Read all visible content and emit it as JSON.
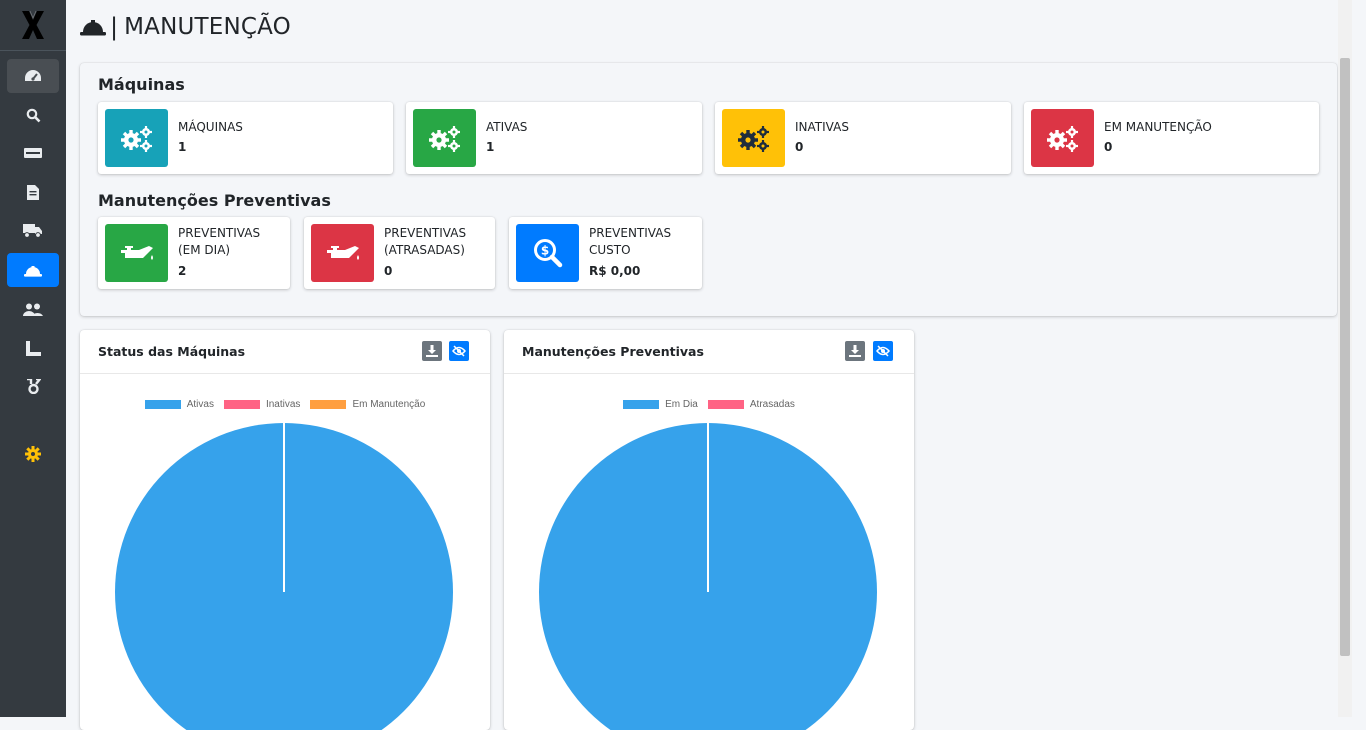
{
  "brand": {
    "logo": "X"
  },
  "sidebar": {
    "items": [
      {
        "icon": "tachometer-icon"
      },
      {
        "icon": "search-icon"
      },
      {
        "icon": "id-card-icon"
      },
      {
        "icon": "file-icon"
      },
      {
        "icon": "truck-icon"
      },
      {
        "icon": "hard-hat-icon",
        "active": true
      },
      {
        "icon": "users-icon"
      },
      {
        "icon": "ruler-combined-icon"
      },
      {
        "icon": "flask-icon"
      },
      {
        "icon": "gear-icon"
      }
    ]
  },
  "header": {
    "title": "MANUTENÇÃO",
    "separator": "|",
    "icon": "hard-hat-icon"
  },
  "maquinas": {
    "title": "Máquinas",
    "boxes": [
      {
        "label": "MÁQUINAS",
        "value": "1",
        "color": "#17a2b8",
        "icon": "cogs-icon"
      },
      {
        "label": "ATIVAS",
        "value": "1",
        "color": "#28a745",
        "icon": "cogs-icon"
      },
      {
        "label": "INATIVAS",
        "value": "0",
        "color": "#ffc107",
        "icon": "cogs-icon"
      },
      {
        "label": "EM MANUTENÇÃO",
        "value": "0",
        "color": "#dc3545",
        "icon": "cogs-icon"
      }
    ]
  },
  "preventivas": {
    "title": "Manutenções Preventivas",
    "boxes": [
      {
        "label_line1": "PREVENTIVAS",
        "label_line2": "(EM DIA)",
        "value": "2",
        "color": "#28a745",
        "icon": "oil-can-icon"
      },
      {
        "label_line1": "PREVENTIVAS",
        "label_line2": "(ATRASADAS)",
        "value": "0",
        "color": "#dc3545",
        "icon": "oil-can-icon"
      },
      {
        "label_line1": "PREVENTIVAS",
        "label_line2": "CUSTO",
        "value": "R$ 0,00",
        "color": "#007bff",
        "icon": "search-dollar-icon"
      }
    ]
  },
  "charts": {
    "status": {
      "title": "Status das Máquinas",
      "legend": [
        "Ativas",
        "Inativas",
        "Em Manutenção"
      ]
    },
    "preventivas": {
      "title": "Manutenções Preventivas",
      "legend": [
        "Em Dia",
        "Atrasadas"
      ]
    }
  },
  "chart_data": [
    {
      "type": "pie",
      "title": "Status das Máquinas",
      "categories": [
        "Ativas",
        "Inativas",
        "Em Manutenção"
      ],
      "values": [
        1,
        0,
        0
      ],
      "colors": [
        "#36a2eb",
        "#ff6384",
        "#ff9f40"
      ],
      "legend_position": "top"
    },
    {
      "type": "pie",
      "title": "Manutenções Preventivas",
      "categories": [
        "Em Dia",
        "Atrasadas"
      ],
      "values": [
        2,
        0
      ],
      "colors": [
        "#36a2eb",
        "#ff6384"
      ],
      "legend_position": "top"
    }
  ]
}
